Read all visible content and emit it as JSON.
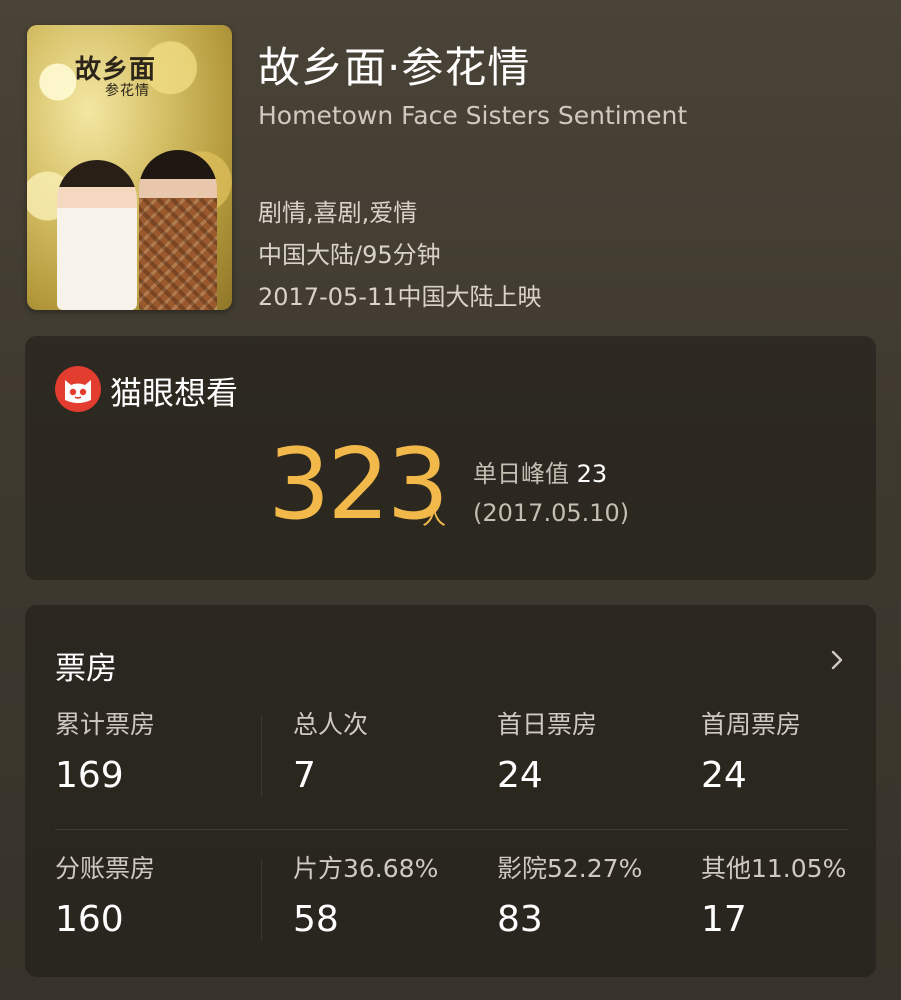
{
  "movie": {
    "poster_calligraphy_line1": "故乡面",
    "poster_calligraphy_line2": "参花情",
    "title": "故乡面·参花情",
    "english_title": "Hometown Face Sisters Sentiment",
    "genres": "剧情,喜剧,爱情",
    "region_runtime": "中国大陆/95分钟",
    "release": "2017-05-11中国大陆上映"
  },
  "wish": {
    "label": "猫眼想看",
    "count": "323",
    "unit": "人",
    "peak_label": "单日峰值",
    "peak_value": "23",
    "peak_date": "(2017.05.10)"
  },
  "box_office": {
    "title": "票房",
    "row1": [
      {
        "label": "累计票房",
        "value": "169"
      },
      {
        "label": "总人次",
        "value": "7"
      },
      {
        "label": "首日票房",
        "value": "24"
      },
      {
        "label": "首周票房",
        "value": "24"
      }
    ],
    "row2": [
      {
        "label": "分账票房",
        "value": "160"
      },
      {
        "label": "片方36.68%",
        "value": "58"
      },
      {
        "label": "影院52.27%",
        "value": "83"
      },
      {
        "label": "其他11.05%",
        "value": "17"
      }
    ]
  },
  "colors": {
    "accent": "#f2b94a",
    "brand_red": "#e23d2e"
  },
  "icons": {
    "logo": "maoyan-cat-icon",
    "more": "chevron-right-icon"
  }
}
